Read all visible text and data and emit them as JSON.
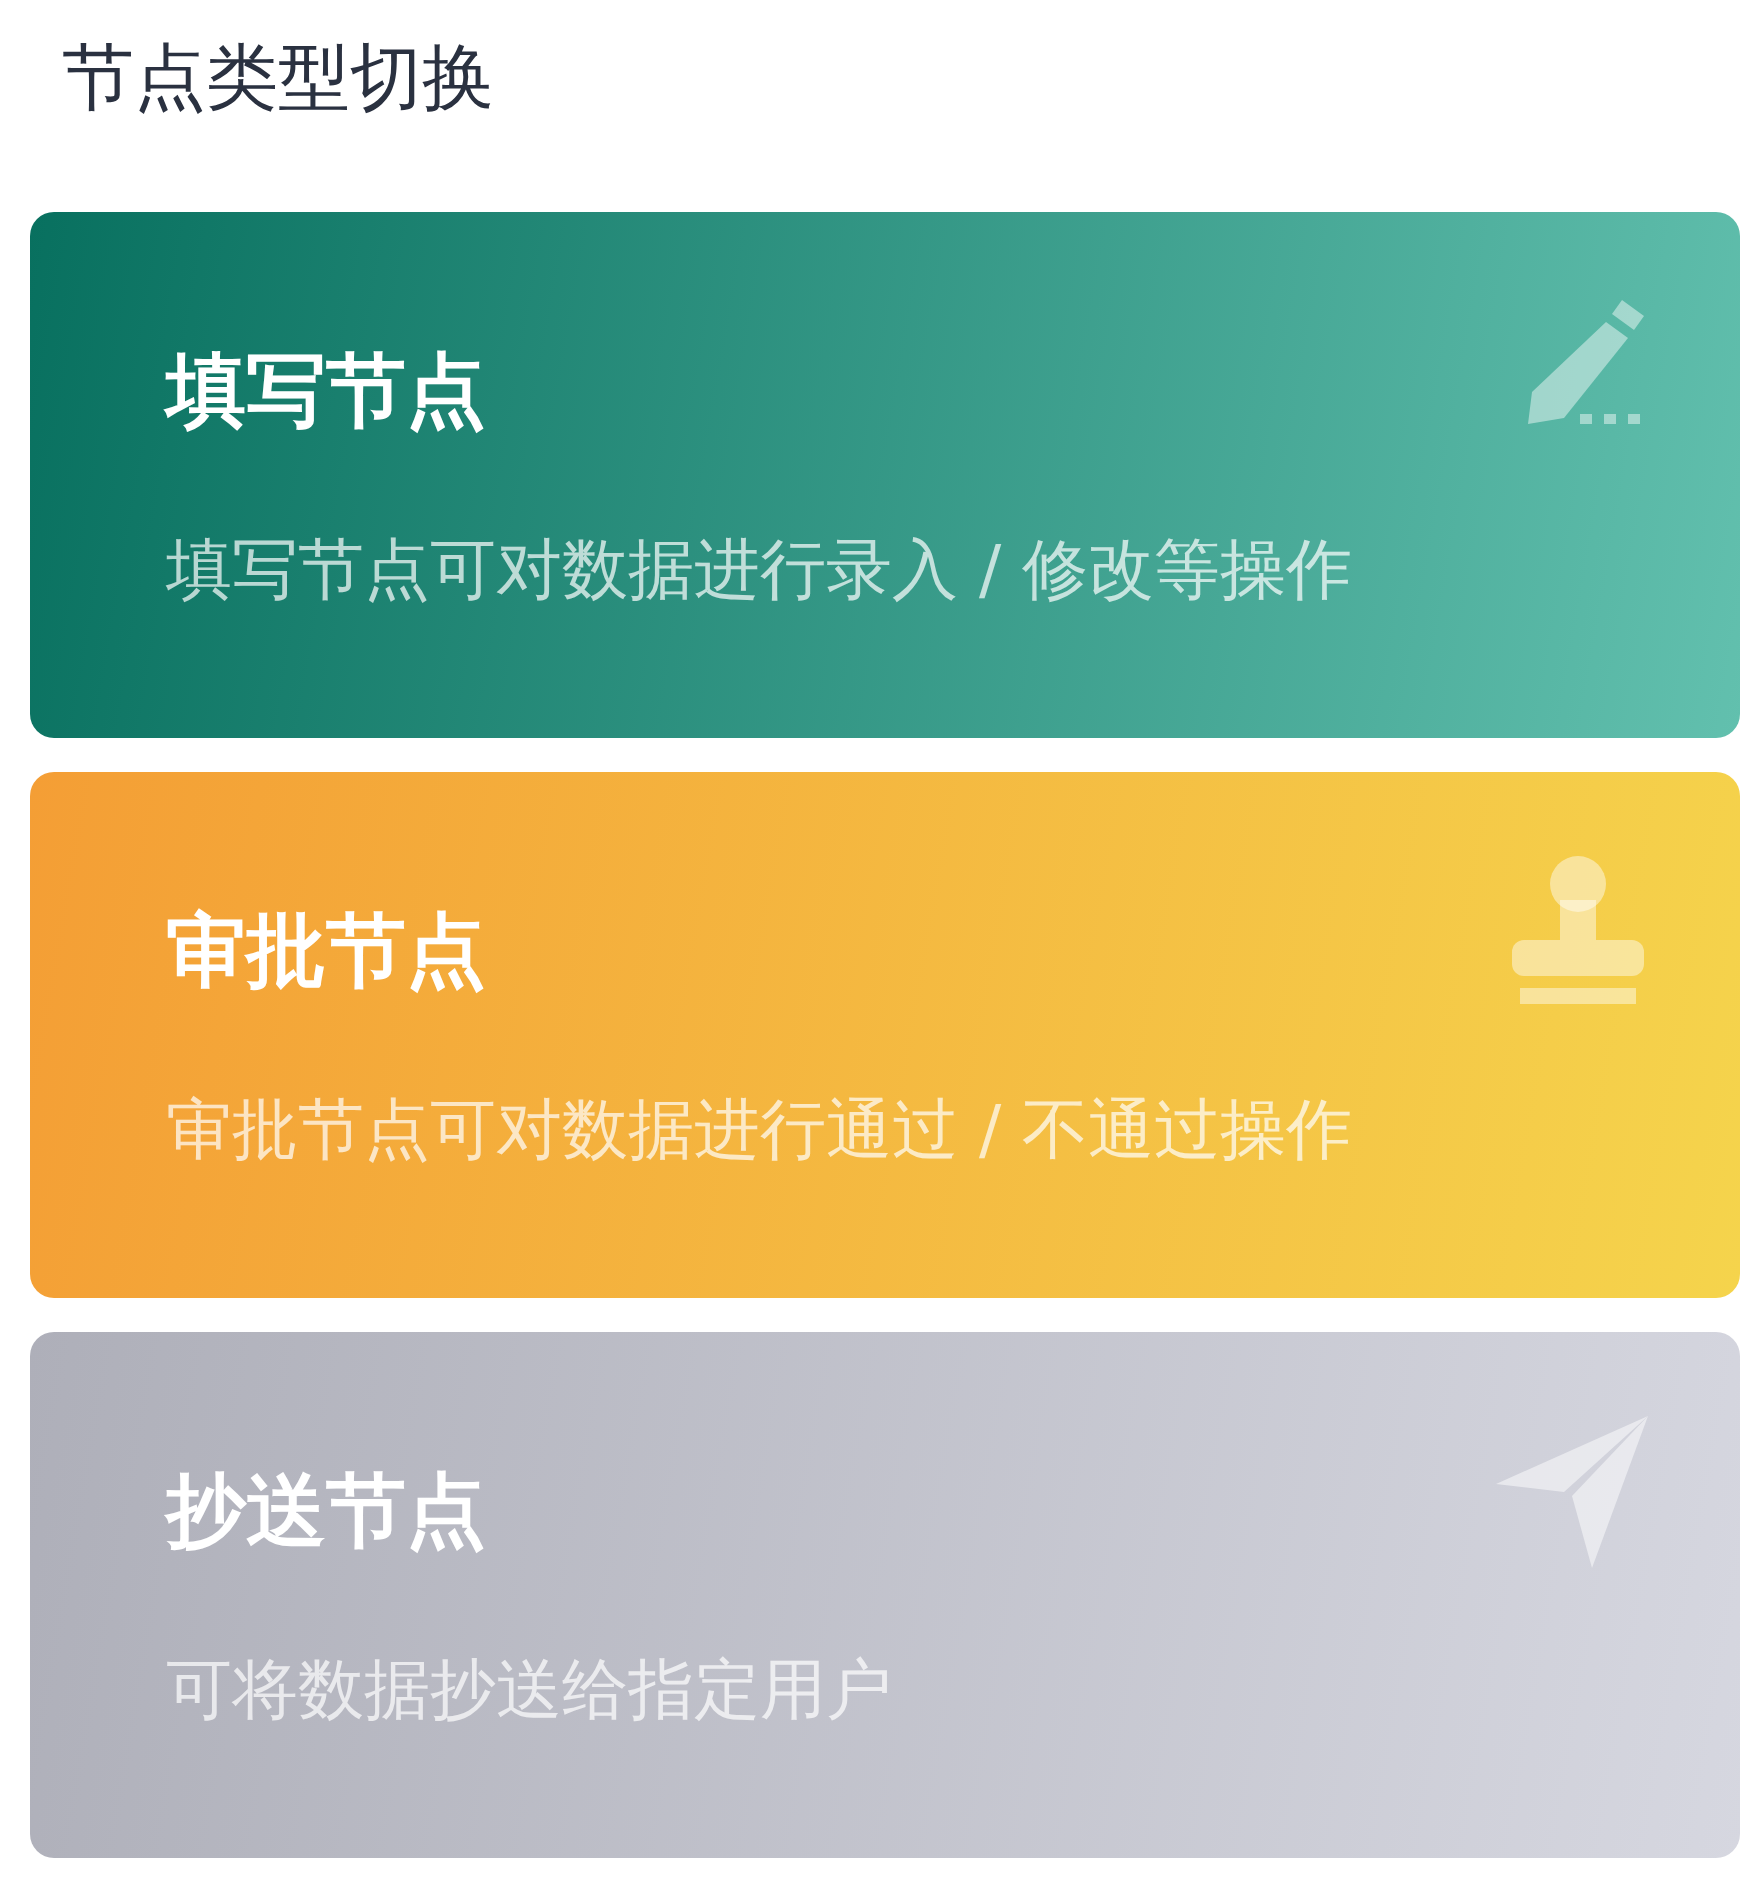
{
  "title": "节点类型切换",
  "cards": [
    {
      "kind": "fill",
      "title": "填写节点",
      "description": "填写节点可对数据进行录入 / 修改等操作"
    },
    {
      "kind": "approve",
      "title": "审批节点",
      "description": "审批节点可对数据进行通过 / 不通过操作"
    },
    {
      "kind": "cc",
      "title": "抄送节点",
      "description": "可将数据抄送给指定用户"
    }
  ]
}
